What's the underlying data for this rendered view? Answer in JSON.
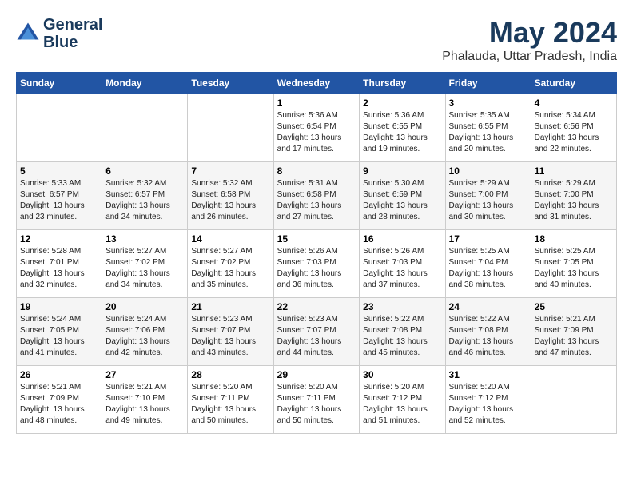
{
  "header": {
    "logo_line1": "General",
    "logo_line2": "Blue",
    "month": "May 2024",
    "location": "Phalauda, Uttar Pradesh, India"
  },
  "days_of_week": [
    "Sunday",
    "Monday",
    "Tuesday",
    "Wednesday",
    "Thursday",
    "Friday",
    "Saturday"
  ],
  "weeks": [
    [
      {
        "day": "",
        "sunrise": "",
        "sunset": "",
        "daylight": ""
      },
      {
        "day": "",
        "sunrise": "",
        "sunset": "",
        "daylight": ""
      },
      {
        "day": "",
        "sunrise": "",
        "sunset": "",
        "daylight": ""
      },
      {
        "day": "1",
        "sunrise": "Sunrise: 5:36 AM",
        "sunset": "Sunset: 6:54 PM",
        "daylight": "Daylight: 13 hours and 17 minutes."
      },
      {
        "day": "2",
        "sunrise": "Sunrise: 5:36 AM",
        "sunset": "Sunset: 6:55 PM",
        "daylight": "Daylight: 13 hours and 19 minutes."
      },
      {
        "day": "3",
        "sunrise": "Sunrise: 5:35 AM",
        "sunset": "Sunset: 6:55 PM",
        "daylight": "Daylight: 13 hours and 20 minutes."
      },
      {
        "day": "4",
        "sunrise": "Sunrise: 5:34 AM",
        "sunset": "Sunset: 6:56 PM",
        "daylight": "Daylight: 13 hours and 22 minutes."
      }
    ],
    [
      {
        "day": "5",
        "sunrise": "Sunrise: 5:33 AM",
        "sunset": "Sunset: 6:57 PM",
        "daylight": "Daylight: 13 hours and 23 minutes."
      },
      {
        "day": "6",
        "sunrise": "Sunrise: 5:32 AM",
        "sunset": "Sunset: 6:57 PM",
        "daylight": "Daylight: 13 hours and 24 minutes."
      },
      {
        "day": "7",
        "sunrise": "Sunrise: 5:32 AM",
        "sunset": "Sunset: 6:58 PM",
        "daylight": "Daylight: 13 hours and 26 minutes."
      },
      {
        "day": "8",
        "sunrise": "Sunrise: 5:31 AM",
        "sunset": "Sunset: 6:58 PM",
        "daylight": "Daylight: 13 hours and 27 minutes."
      },
      {
        "day": "9",
        "sunrise": "Sunrise: 5:30 AM",
        "sunset": "Sunset: 6:59 PM",
        "daylight": "Daylight: 13 hours and 28 minutes."
      },
      {
        "day": "10",
        "sunrise": "Sunrise: 5:29 AM",
        "sunset": "Sunset: 7:00 PM",
        "daylight": "Daylight: 13 hours and 30 minutes."
      },
      {
        "day": "11",
        "sunrise": "Sunrise: 5:29 AM",
        "sunset": "Sunset: 7:00 PM",
        "daylight": "Daylight: 13 hours and 31 minutes."
      }
    ],
    [
      {
        "day": "12",
        "sunrise": "Sunrise: 5:28 AM",
        "sunset": "Sunset: 7:01 PM",
        "daylight": "Daylight: 13 hours and 32 minutes."
      },
      {
        "day": "13",
        "sunrise": "Sunrise: 5:27 AM",
        "sunset": "Sunset: 7:02 PM",
        "daylight": "Daylight: 13 hours and 34 minutes."
      },
      {
        "day": "14",
        "sunrise": "Sunrise: 5:27 AM",
        "sunset": "Sunset: 7:02 PM",
        "daylight": "Daylight: 13 hours and 35 minutes."
      },
      {
        "day": "15",
        "sunrise": "Sunrise: 5:26 AM",
        "sunset": "Sunset: 7:03 PM",
        "daylight": "Daylight: 13 hours and 36 minutes."
      },
      {
        "day": "16",
        "sunrise": "Sunrise: 5:26 AM",
        "sunset": "Sunset: 7:03 PM",
        "daylight": "Daylight: 13 hours and 37 minutes."
      },
      {
        "day": "17",
        "sunrise": "Sunrise: 5:25 AM",
        "sunset": "Sunset: 7:04 PM",
        "daylight": "Daylight: 13 hours and 38 minutes."
      },
      {
        "day": "18",
        "sunrise": "Sunrise: 5:25 AM",
        "sunset": "Sunset: 7:05 PM",
        "daylight": "Daylight: 13 hours and 40 minutes."
      }
    ],
    [
      {
        "day": "19",
        "sunrise": "Sunrise: 5:24 AM",
        "sunset": "Sunset: 7:05 PM",
        "daylight": "Daylight: 13 hours and 41 minutes."
      },
      {
        "day": "20",
        "sunrise": "Sunrise: 5:24 AM",
        "sunset": "Sunset: 7:06 PM",
        "daylight": "Daylight: 13 hours and 42 minutes."
      },
      {
        "day": "21",
        "sunrise": "Sunrise: 5:23 AM",
        "sunset": "Sunset: 7:07 PM",
        "daylight": "Daylight: 13 hours and 43 minutes."
      },
      {
        "day": "22",
        "sunrise": "Sunrise: 5:23 AM",
        "sunset": "Sunset: 7:07 PM",
        "daylight": "Daylight: 13 hours and 44 minutes."
      },
      {
        "day": "23",
        "sunrise": "Sunrise: 5:22 AM",
        "sunset": "Sunset: 7:08 PM",
        "daylight": "Daylight: 13 hours and 45 minutes."
      },
      {
        "day": "24",
        "sunrise": "Sunrise: 5:22 AM",
        "sunset": "Sunset: 7:08 PM",
        "daylight": "Daylight: 13 hours and 46 minutes."
      },
      {
        "day": "25",
        "sunrise": "Sunrise: 5:21 AM",
        "sunset": "Sunset: 7:09 PM",
        "daylight": "Daylight: 13 hours and 47 minutes."
      }
    ],
    [
      {
        "day": "26",
        "sunrise": "Sunrise: 5:21 AM",
        "sunset": "Sunset: 7:09 PM",
        "daylight": "Daylight: 13 hours and 48 minutes."
      },
      {
        "day": "27",
        "sunrise": "Sunrise: 5:21 AM",
        "sunset": "Sunset: 7:10 PM",
        "daylight": "Daylight: 13 hours and 49 minutes."
      },
      {
        "day": "28",
        "sunrise": "Sunrise: 5:20 AM",
        "sunset": "Sunset: 7:11 PM",
        "daylight": "Daylight: 13 hours and 50 minutes."
      },
      {
        "day": "29",
        "sunrise": "Sunrise: 5:20 AM",
        "sunset": "Sunset: 7:11 PM",
        "daylight": "Daylight: 13 hours and 50 minutes."
      },
      {
        "day": "30",
        "sunrise": "Sunrise: 5:20 AM",
        "sunset": "Sunset: 7:12 PM",
        "daylight": "Daylight: 13 hours and 51 minutes."
      },
      {
        "day": "31",
        "sunrise": "Sunrise: 5:20 AM",
        "sunset": "Sunset: 7:12 PM",
        "daylight": "Daylight: 13 hours and 52 minutes."
      },
      {
        "day": "",
        "sunrise": "",
        "sunset": "",
        "daylight": ""
      }
    ]
  ]
}
